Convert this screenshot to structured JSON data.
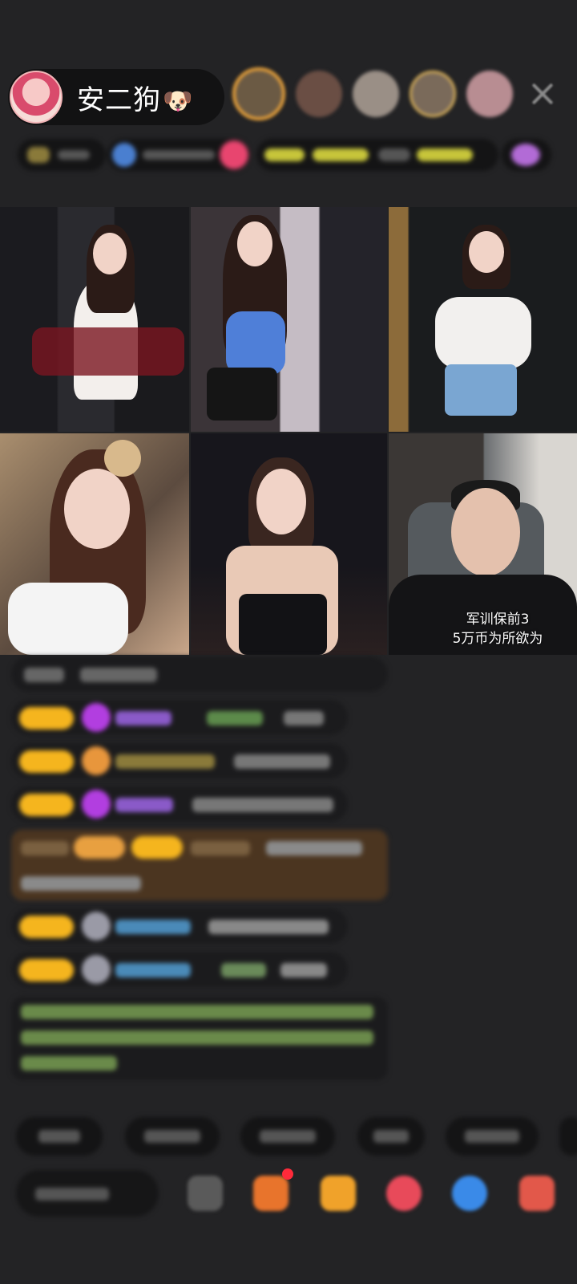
{
  "host": {
    "name": "安二狗",
    "name_emoji": "🐶"
  },
  "top_viewers": [
    "viewer-1",
    "viewer-2",
    "viewer-3",
    "viewer-4",
    "viewer-5"
  ],
  "video_grid": {
    "tiles": [
      "tile-1",
      "tile-2",
      "tile-3",
      "tile-4",
      "tile-5",
      "tile-6"
    ],
    "caption": {
      "line1": "军训保前3",
      "line2": "5万币为所欲为"
    }
  },
  "colors": {
    "background": "#232325",
    "pill": "#121213",
    "badge_gold": "#f5b51e",
    "purple_gem": "#b23ee0",
    "gift_highlight": "#4b3520",
    "chat_green": "#8fd45d"
  }
}
